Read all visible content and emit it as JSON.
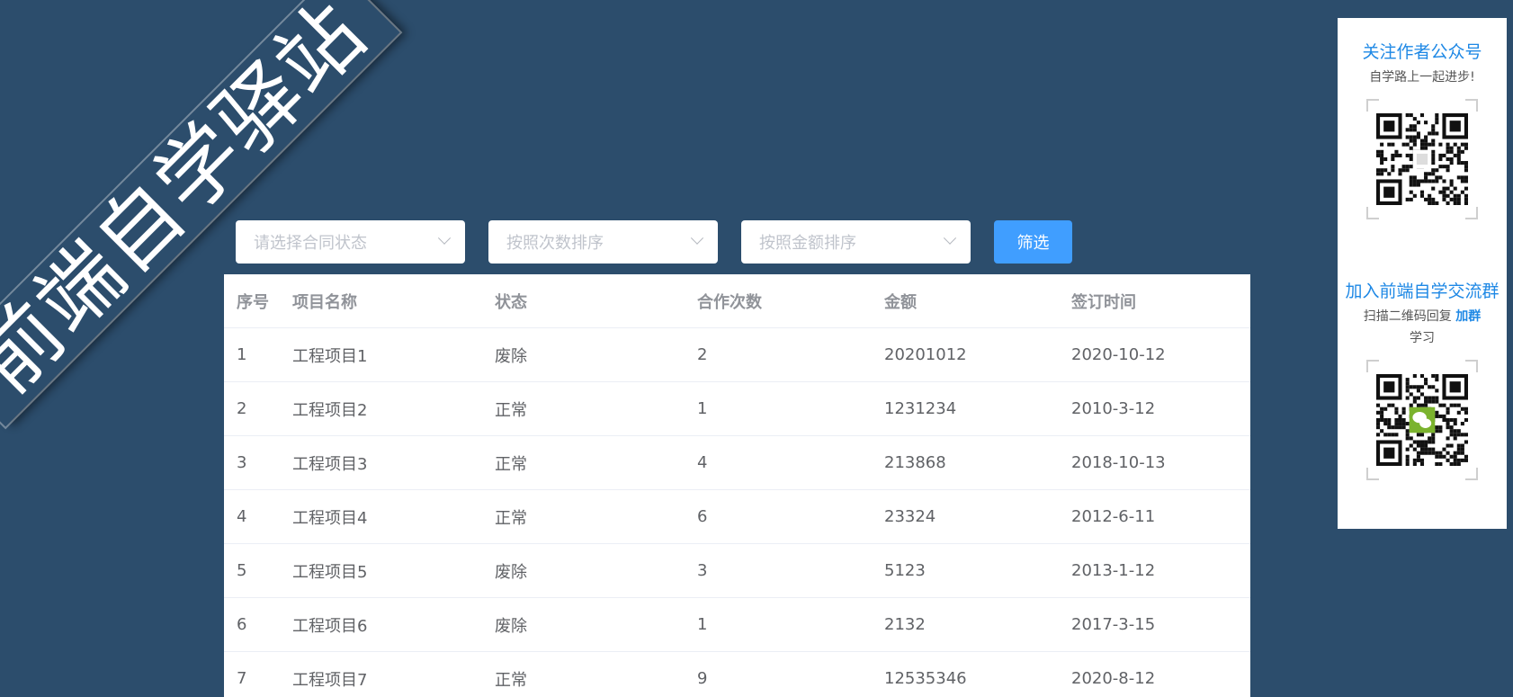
{
  "banner": {
    "text": "前端自学驿站"
  },
  "filters": {
    "status_placeholder": "请选择合同状态",
    "count_sort_placeholder": "按照次数排序",
    "amount_sort_placeholder": "按照金额排序",
    "filter_button": "筛选"
  },
  "table": {
    "headers": [
      "序号",
      "项目名称",
      "状态",
      "合作次数",
      "金额",
      "签订时间"
    ],
    "rows": [
      [
        "1",
        "工程项目1",
        "废除",
        "2",
        "20201012",
        "2020-10-12"
      ],
      [
        "2",
        "工程项目2",
        "正常",
        "1",
        "1231234",
        "2010-3-12"
      ],
      [
        "3",
        "工程项目3",
        "正常",
        "4",
        "213868",
        "2018-10-13"
      ],
      [
        "4",
        "工程项目4",
        "正常",
        "6",
        "23324",
        "2012-6-11"
      ],
      [
        "5",
        "工程项目5",
        "废除",
        "3",
        "5123",
        "2013-1-12"
      ],
      [
        "6",
        "工程项目6",
        "废除",
        "1",
        "2132",
        "2017-3-15"
      ],
      [
        "7",
        "工程项目7",
        "正常",
        "9",
        "12535346",
        "2020-8-12"
      ]
    ]
  },
  "promo": {
    "follow_title": "关注作者公众号",
    "follow_sub": "自学路上一起进步!",
    "group_title": "加入前端自学交流群",
    "group_sub_prefix": "扫描二维码回复 ",
    "group_sub_highlight": "加群",
    "group_sub_suffix": "学习"
  },
  "colors": {
    "background": "#2c4d6c",
    "primary_button": "#409eff",
    "promo_title": "#1e88e5"
  }
}
